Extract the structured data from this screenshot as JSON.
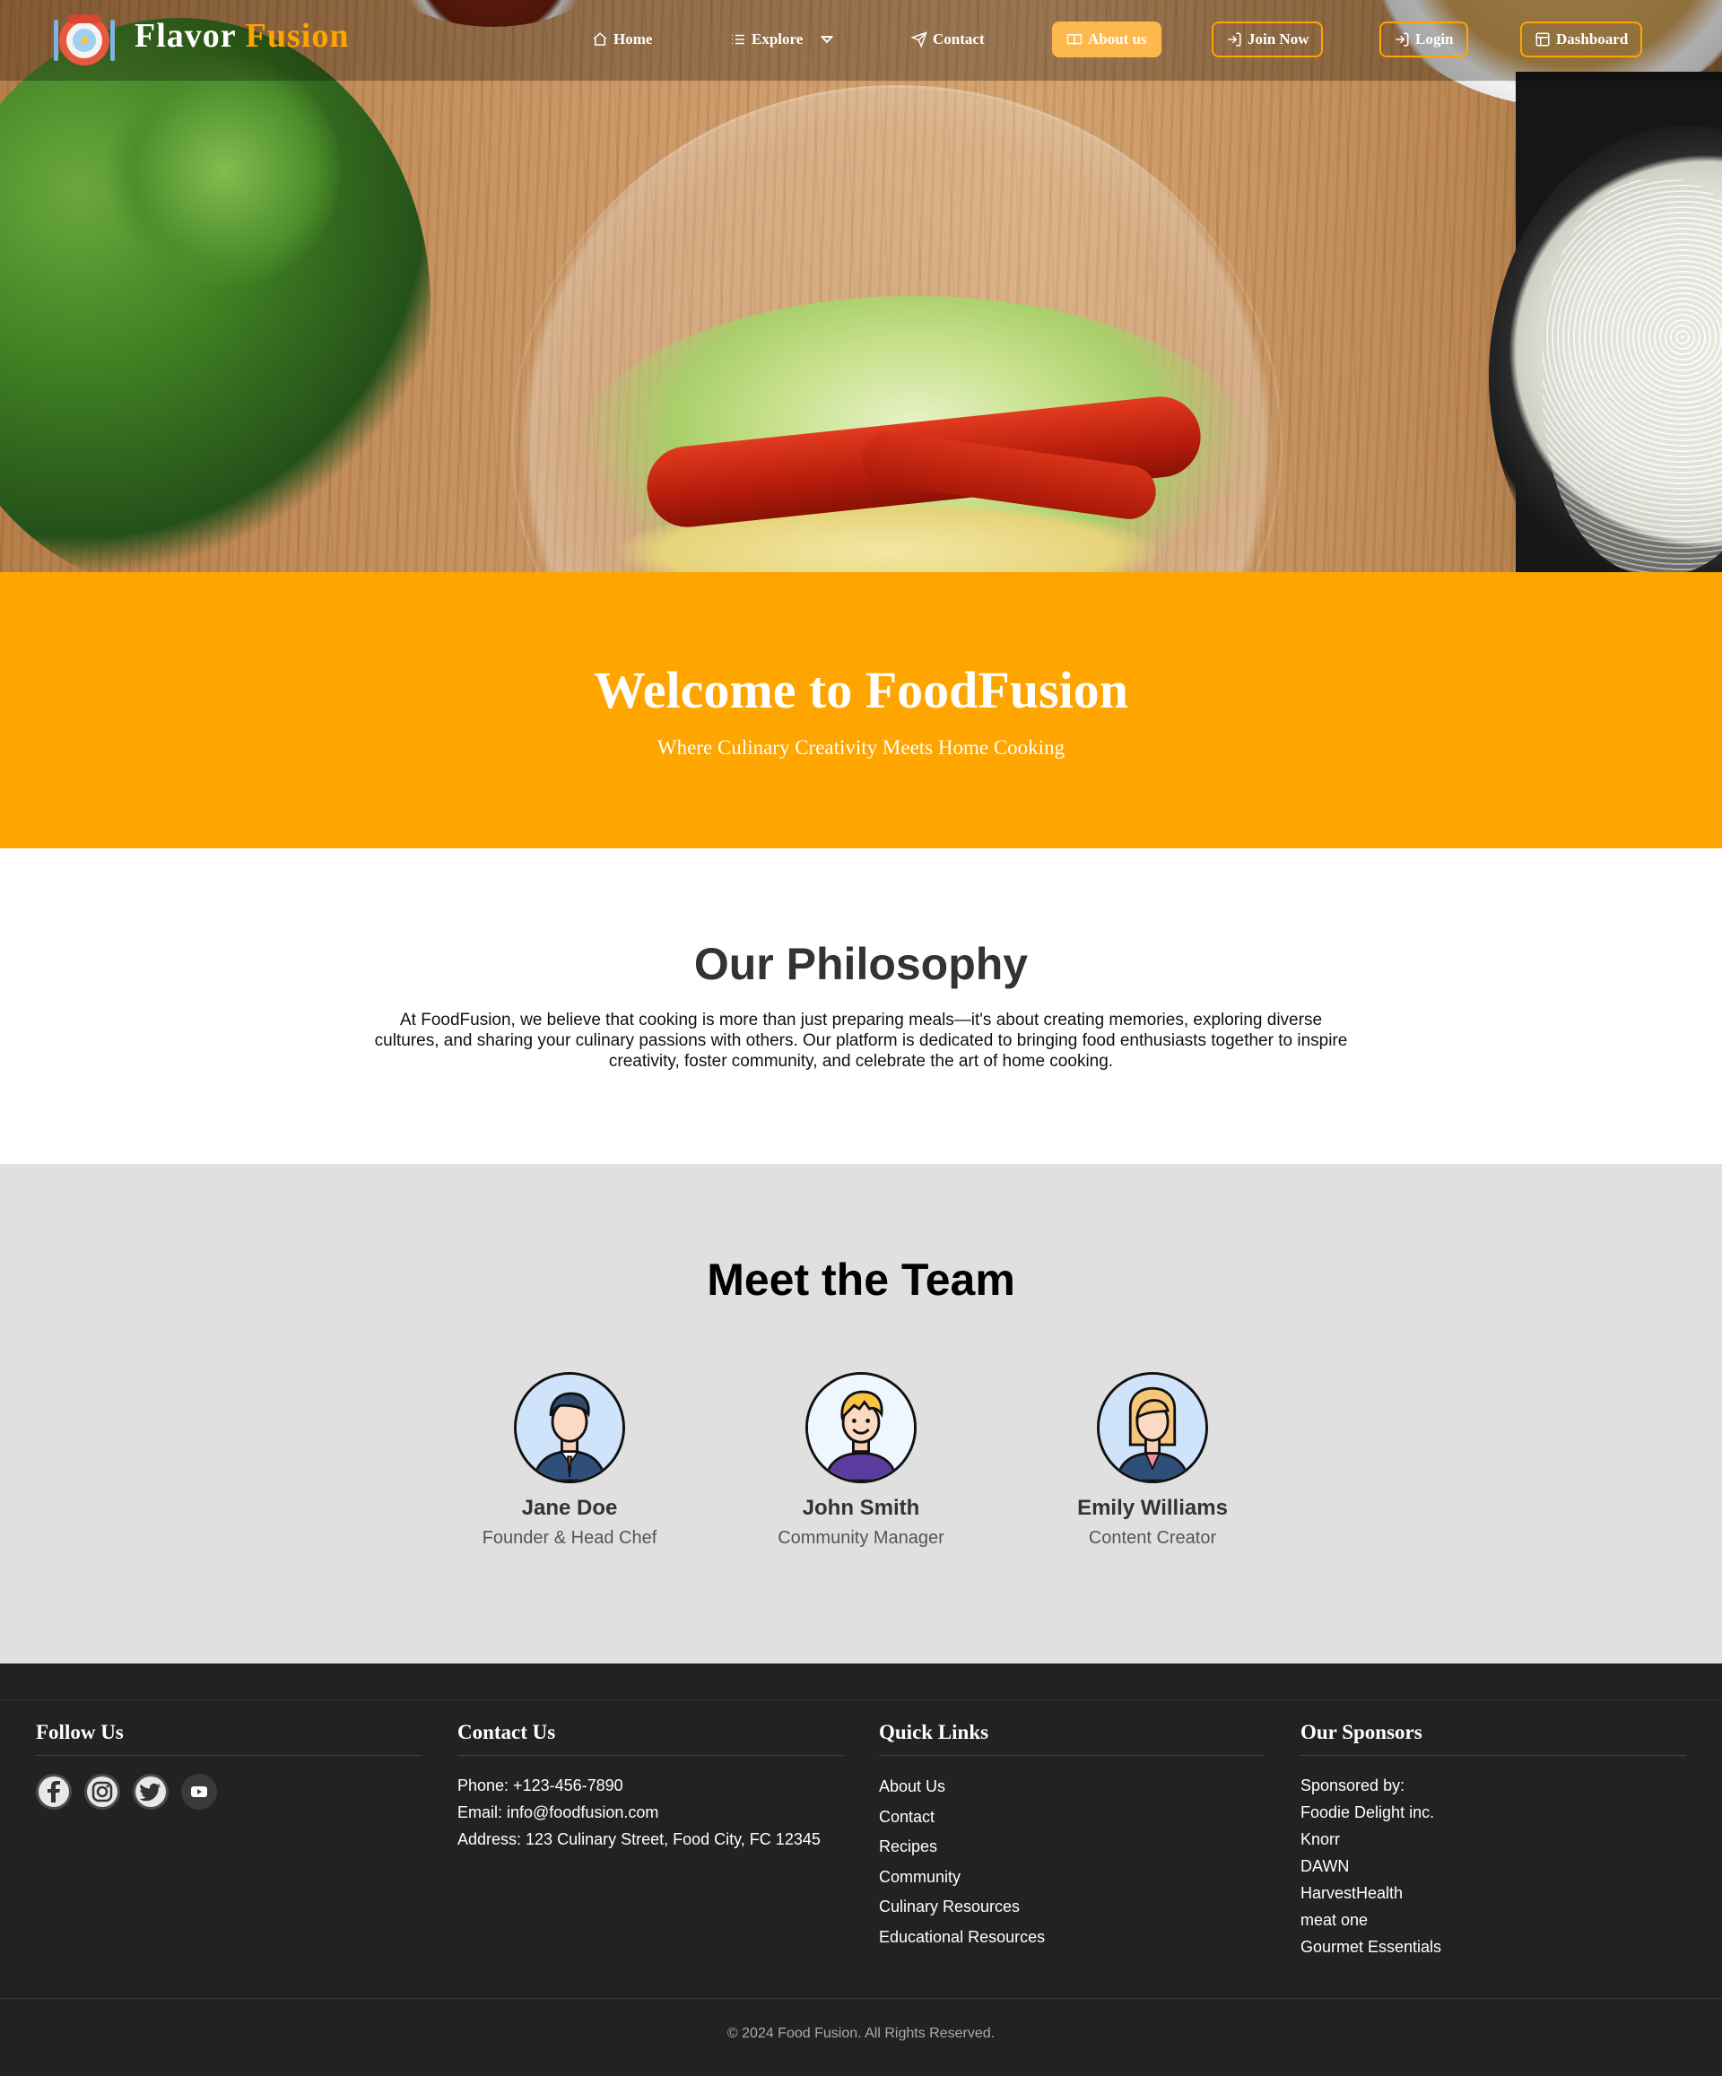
{
  "brand": {
    "word1": "Flavor",
    "word2": "Fusion",
    "logo_icon": "plate-fork-knife-icon"
  },
  "nav": {
    "home": "Home",
    "explore": "Explore",
    "contact": "Contact",
    "about": "About us",
    "join": "Join Now",
    "login": "Login",
    "dashboard": "Dashboard",
    "active": "About us"
  },
  "welcome": {
    "title": "Welcome to FoodFusion",
    "subtitle": "Where Culinary Creativity Meets Home Cooking"
  },
  "philosophy": {
    "title": "Our Philosophy",
    "text": "At FoodFusion, we believe that cooking is more than just preparing meals—it's about creating memories, exploring diverse cultures, and sharing your culinary passions with others. Our platform is dedicated to bringing food enthusiasts together to inspire creativity, foster community, and celebrate the art of home cooking."
  },
  "team": {
    "title": "Meet the Team",
    "members": [
      {
        "name": "Jane Doe",
        "role": "Founder & Head Chef"
      },
      {
        "name": "John Smith",
        "role": "Community Manager"
      },
      {
        "name": "Emily Williams",
        "role": "Content Creator"
      }
    ]
  },
  "footer": {
    "follow": {
      "title": "Follow Us",
      "icons": [
        "facebook-icon",
        "instagram-icon",
        "twitter-icon",
        "youtube-icon"
      ]
    },
    "contact": {
      "title": "Contact Us",
      "items": [
        "Phone: +123-456-7890",
        "Email: info@foodfusion.com",
        "Address: 123 Culinary Street, Food City, FC 12345"
      ]
    },
    "links": {
      "title": "Quick Links",
      "items": [
        "About Us",
        "Contact",
        "Recipes",
        "Community",
        "Culinary Resources",
        "Educational Resources"
      ]
    },
    "sponsors": {
      "title": "Our Sponsors",
      "items": [
        "Sponsored by:",
        "Foodie Delight inc.",
        "Knorr",
        "DAWN",
        "HarvestHealth",
        "meat one",
        "Gourmet Essentials"
      ]
    },
    "copyright": "© 2024 Food Fusion. All Rights Reserved."
  },
  "colors": {
    "accent": "#ffa500",
    "footer_bg": "#222222",
    "team_bg": "#e0e0e0"
  }
}
